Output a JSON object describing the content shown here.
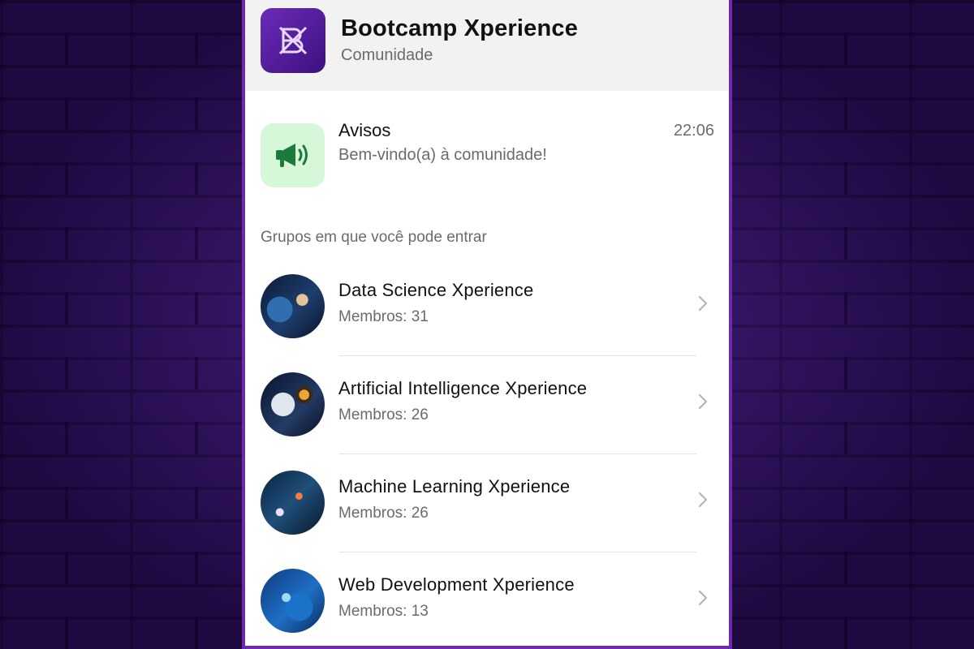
{
  "community": {
    "title": "Bootcamp Xperience",
    "subtitle": "Comunidade",
    "logo_icon": "bx-logo-icon",
    "logo_color": "#5a1f9e"
  },
  "announcements": {
    "title": "Avisos",
    "time": "22:06",
    "message": "Bem-vindo(a) à comunidade!",
    "icon": "megaphone-icon",
    "icon_color": "#1e7a3c",
    "icon_bg": "#d6f8d9"
  },
  "groups_section": {
    "title": "Grupos em que você pode entrar",
    "items": [
      {
        "name": "Data Science Xperience",
        "members": "Membros: 31"
      },
      {
        "name": "Artificial Intelligence Xperience",
        "members": "Membros: 26"
      },
      {
        "name": "Machine Learning Xperience",
        "members": "Membros: 26"
      },
      {
        "name": "Web Development Xperience",
        "members": "Membros: 13"
      }
    ]
  },
  "theme": {
    "accent": "#6f2aa8",
    "background": "#2a0f58"
  }
}
